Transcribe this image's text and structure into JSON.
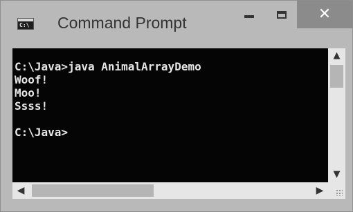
{
  "window": {
    "title": "Command Prompt",
    "icon": "cmd-icon",
    "icon_label": "C:\\",
    "controls": {
      "minimize": "minimize-icon",
      "maximize": "maximize-icon",
      "close": "close-icon",
      "close_glyph": "✕"
    }
  },
  "console": {
    "lines": [
      "C:\\Java>java AnimalArrayDemo",
      "Woof!",
      "Moo!",
      "Ssss!",
      "",
      "C:\\Java>"
    ],
    "text": "C:\\Java>java AnimalArrayDemo\nWoof!\nMoo!\nSsss!\n\nC:\\Java>"
  },
  "scrollbars": {
    "up": "▲",
    "down": "▼",
    "left": "◀",
    "right": "▶"
  },
  "colors": {
    "console_bg": "#050505",
    "console_fg": "#e6e6e6",
    "chrome": "#b9b9b9",
    "close_button": "#8b8b8b"
  }
}
